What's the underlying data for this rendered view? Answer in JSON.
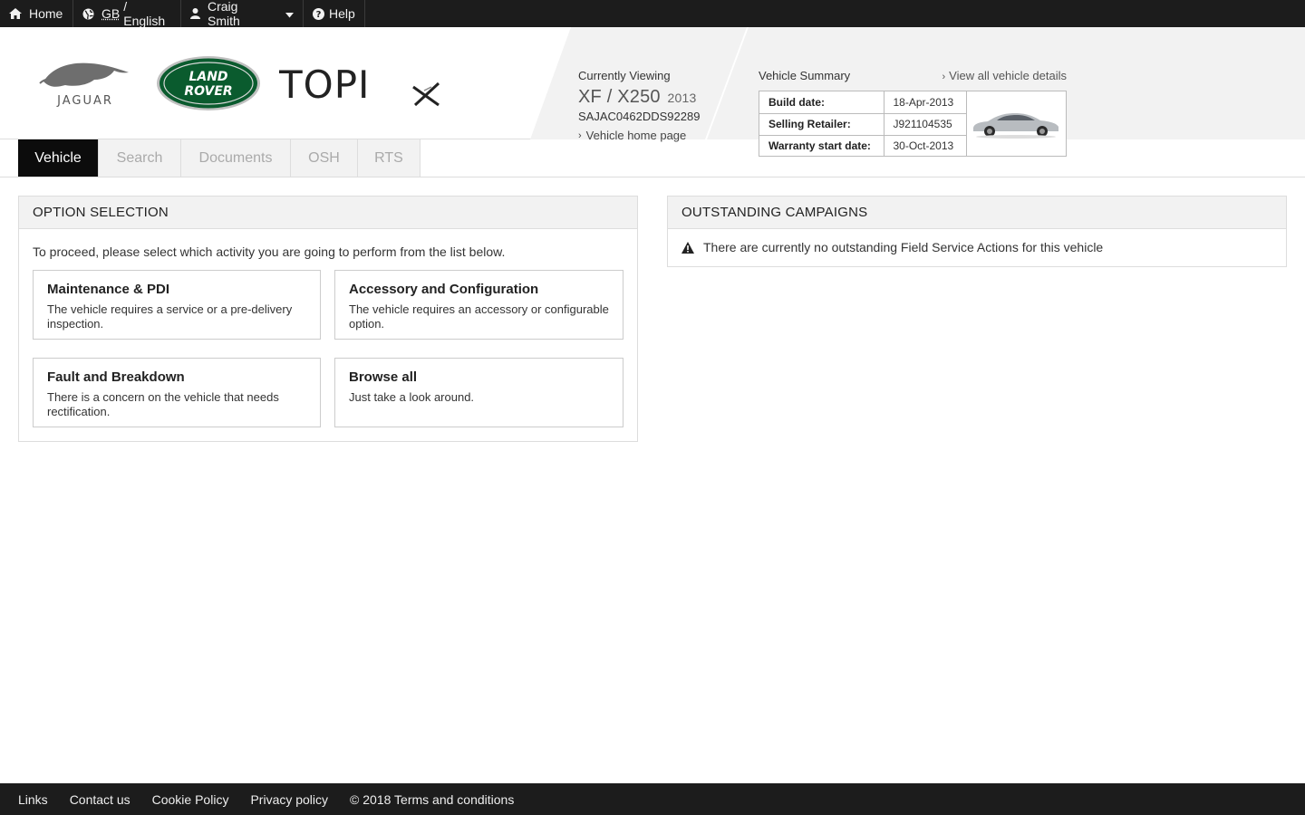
{
  "topbar": {
    "home": "Home",
    "locale_region": "GB",
    "locale_language": " / English",
    "user": "Craig Smith",
    "help": "Help"
  },
  "header": {
    "brands": [
      "Jaguar",
      "Land Rover",
      "TOPIx"
    ],
    "currently_viewing_label": "Currently Viewing",
    "model": "XF / X250",
    "model_year": "2013",
    "vin": "SAJAC0462DDS92289",
    "vehicle_home_link": "Vehicle home page",
    "summary_title": "Vehicle Summary",
    "view_all_link": "View all vehicle details",
    "summary_rows": [
      {
        "key": "Build date:",
        "value": "18-Apr-2013"
      },
      {
        "key": "Selling Retailer:",
        "value": "J921104535"
      },
      {
        "key": "Warranty start date:",
        "value": "30-Oct-2013"
      }
    ]
  },
  "tabs": [
    {
      "label": "Vehicle",
      "active": true
    },
    {
      "label": "Search",
      "active": false
    },
    {
      "label": "Documents",
      "active": false
    },
    {
      "label": "OSH",
      "active": false
    },
    {
      "label": "RTS",
      "active": false
    }
  ],
  "option_selection": {
    "title": "OPTION SELECTION",
    "intro": "To proceed, please select which activity you are going to perform from the list below.",
    "cards": [
      {
        "title": "Maintenance & PDI",
        "desc": "The vehicle requires a service or a pre-delivery inspection."
      },
      {
        "title": "Accessory and Configuration",
        "desc": "The vehicle requires an accessory or configurable option."
      },
      {
        "title": "Fault and Breakdown",
        "desc": "There is a concern on the vehicle that needs rectification."
      },
      {
        "title": "Browse all",
        "desc": "Just take a look around."
      }
    ]
  },
  "campaigns": {
    "title": "OUTSTANDING CAMPAIGNS",
    "message": "There are currently no outstanding Field Service Actions for this vehicle"
  },
  "footer": {
    "links": [
      "Links",
      "Contact us",
      "Cookie Policy",
      "Privacy policy",
      "© 2018 Terms and conditions"
    ]
  },
  "colors": {
    "topbar_bg": "#1c1c1c",
    "active_tab_bg": "#0c0c0c",
    "land_rover_green": "#0a5b2e",
    "panel_header_bg": "#f2f2f2"
  }
}
